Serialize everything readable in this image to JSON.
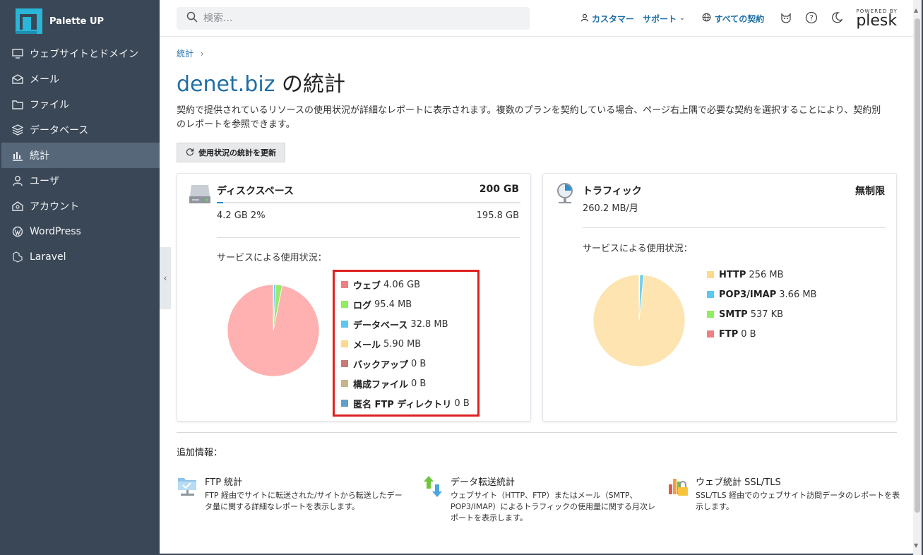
{
  "app": {
    "brand": "Palette UP"
  },
  "sidebar": {
    "items": [
      {
        "label": "ウェブサイトとドメイン",
        "icon": "monitor-icon"
      },
      {
        "label": "メール",
        "icon": "mail-icon"
      },
      {
        "label": "ファイル",
        "icon": "folder-icon"
      },
      {
        "label": "データベース",
        "icon": "database-icon"
      },
      {
        "label": "統計",
        "icon": "bar-chart-icon",
        "active": true
      },
      {
        "label": "ユーザ",
        "icon": "user-icon"
      },
      {
        "label": "アカウント",
        "icon": "account-icon"
      },
      {
        "label": "WordPress",
        "icon": "wordpress-icon"
      },
      {
        "label": "Laravel",
        "icon": "laravel-icon"
      }
    ]
  },
  "header": {
    "search_placeholder": "検索...",
    "customer": "カスタマー",
    "support": "サポート",
    "all_subscriptions": "すべての契約",
    "powered_by": "POWERED BY",
    "plesk": "plesk"
  },
  "page": {
    "breadcrumb": "統計",
    "title_domain": "denet.biz",
    "title_suffix": " の統計",
    "description": "契約で提供されているリソースの使用状況が詳細なレポートに表示されます。複数のプランを契約している場合、ページ右上隅で必要な契約を選択することにより、契約別のレポートを参照できます。",
    "refresh_button": "使用状況の統計を更新"
  },
  "disk": {
    "title": "ディスクスペース",
    "total": "200 GB",
    "used": "4.2 GB 2%",
    "free": "195.8 GB",
    "used_fraction": 0.02,
    "usage_label": "サービスによる使用状況：",
    "legend": [
      {
        "label": "ウェブ",
        "value": "4.06 GB",
        "color": "#f08080"
      },
      {
        "label": "ログ",
        "value": "95.4 MB",
        "color": "#90ee60"
      },
      {
        "label": "データベース",
        "value": "32.8 MB",
        "color": "#5bc8f0"
      },
      {
        "label": "メール",
        "value": "5.90 MB",
        "color": "#fcd98c"
      },
      {
        "label": "バックアップ",
        "value": "0 B",
        "color": "#c97878"
      },
      {
        "label": "構成ファイル",
        "value": "0 B",
        "color": "#c8b48a"
      },
      {
        "label": "匿名 FTP ディレクトリ",
        "value": "0 B",
        "color": "#5f9fc8"
      }
    ]
  },
  "traffic": {
    "title": "トラフィック",
    "total": "無制限",
    "monthly": "260.2 MB/月",
    "usage_label": "サービスによる使用状況：",
    "legend": [
      {
        "label": "HTTP",
        "value": "256 MB",
        "color": "#fcd98c"
      },
      {
        "label": "POP3/IMAP",
        "value": "3.66 MB",
        "color": "#5bc8f0"
      },
      {
        "label": "SMTP",
        "value": "537 KB",
        "color": "#90ee60"
      },
      {
        "label": "FTP",
        "value": "0 B",
        "color": "#f08080"
      }
    ]
  },
  "chart_data": [
    {
      "type": "pie",
      "categories": [
        "ウェブ",
        "ログ",
        "データベース",
        "メール",
        "バックアップ",
        "構成ファイル",
        "匿名 FTP ディレクトリ"
      ],
      "values": [
        4157,
        95.4,
        32.8,
        5.9,
        0,
        0,
        0
      ],
      "colors": [
        "#ffb0b0",
        "#9be96a",
        "#6fcff2",
        "#f8d89a",
        "#c97878",
        "#c8b48a",
        "#5f9fc8"
      ]
    },
    {
      "type": "pie",
      "categories": [
        "HTTP",
        "POP3/IMAP",
        "SMTP",
        "FTP"
      ],
      "values": [
        256,
        3.66,
        0.537,
        0
      ],
      "colors": [
        "#fde4b0",
        "#6fcff2",
        "#9be96a",
        "#f08080"
      ]
    }
  ],
  "extra": {
    "title": "追加情報：",
    "items": [
      {
        "title": "FTP 統計",
        "desc": "FTP 経由でサイトに転送された/サイトから転送したデータ量に関する詳細なレポートを表示します。"
      },
      {
        "title": "データ転送統計",
        "desc": "ウェブサイト（HTTP、FTP）またはメール（SMTP、POP3/IMAP）によるトラフィックの使用量に関する月次レポートを表示します。"
      },
      {
        "title": "ウェブ統計 SSL/TLS",
        "desc": "SSL/TLS 経由でのウェブサイト訪問データのレポートを表示します。"
      }
    ]
  }
}
